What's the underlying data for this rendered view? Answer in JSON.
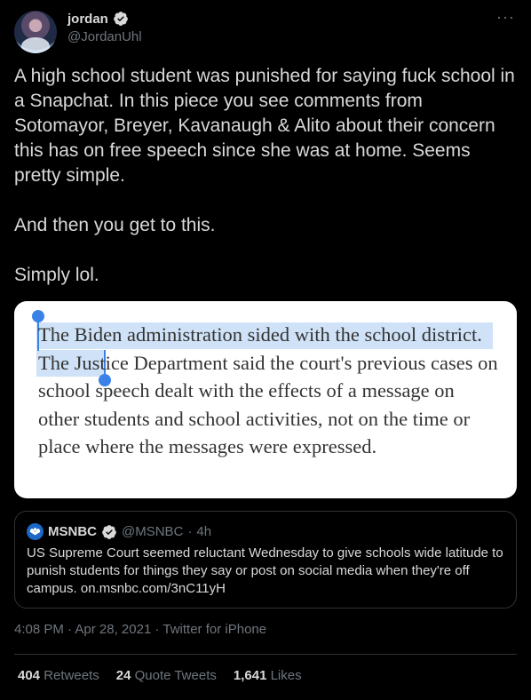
{
  "author": {
    "name": "jordan",
    "handle": "@JordanUhl",
    "verified_icon": "verified-badge-icon",
    "avatar_icon": "avatar"
  },
  "more_label": "···",
  "tweet": {
    "lines": [
      "A high school student was punished for saying fuck school in a Snapchat. In this piece you see comments from Sotomayor, Breyer, Kavanaugh & Alito about their concern this has on free speech since she was at home. Seems pretty simple.",
      "And then you get to this.",
      "Simply lol."
    ]
  },
  "article_image": {
    "highlighted": "The Biden administration sided with the school district.",
    "rest": " The Justice Department said the court's previous cases on school speech dealt with the effects of a message on other students and school activities, not on the time or place where the messages were expressed."
  },
  "quote": {
    "name": "MSNBC",
    "handle": "@MSNBC",
    "separator": "·",
    "time": "4h",
    "text": "US Supreme Court seemed reluctant Wednesday to give schools wide latitude to punish students for things they say or post on social media when they're off campus. on.msnbc.com/3nC11yH"
  },
  "meta": {
    "time": "4:08 PM",
    "separator": "·",
    "date": "Apr 28, 2021",
    "source": "Twitter for iPhone"
  },
  "stats": {
    "retweets_count": "404",
    "retweets_label": "Retweets",
    "quotes_count": "24",
    "quotes_label": "Quote Tweets",
    "likes_count": "1,641",
    "likes_label": "Likes"
  },
  "colors": {
    "background": "#000000",
    "text": "#d9d9d9",
    "secondary": "#6e767d",
    "border": "#2f3336",
    "selection": "#cfe2f7",
    "selection_handle": "#3b82e8"
  }
}
